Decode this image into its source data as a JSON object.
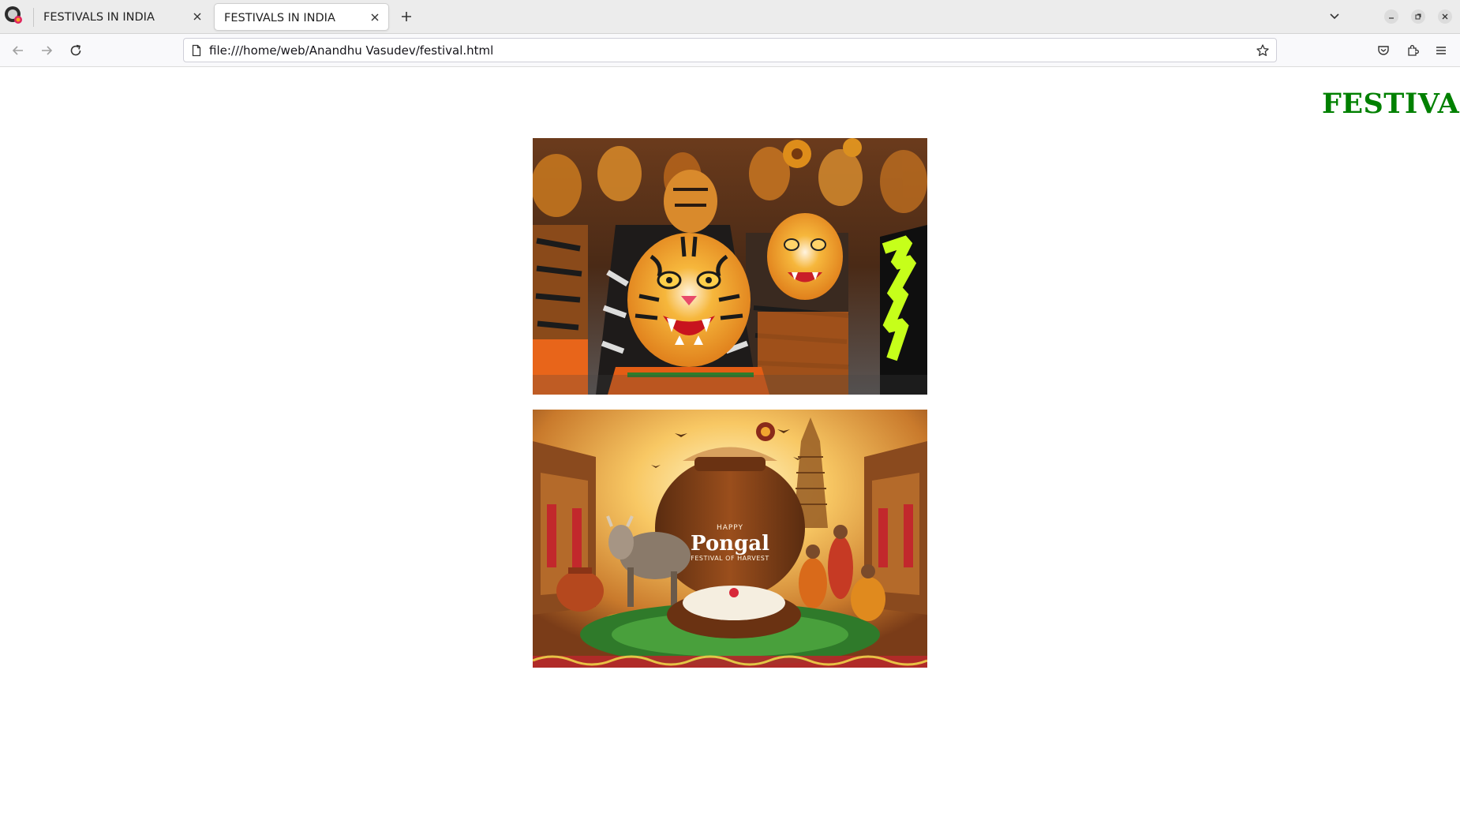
{
  "browser": {
    "tabs": [
      {
        "title": "FESTIVALS IN INDIA",
        "active": false
      },
      {
        "title": "FESTIVALS IN INDIA",
        "active": true
      }
    ],
    "url": "file:///home/web/Anandhu Vasudev/festival.html"
  },
  "page": {
    "heading": "FESTIVAI",
    "heading_color": "#008000",
    "images": [
      {
        "subject": "pulikali-tiger-dancers"
      },
      {
        "subject": "pongal-harvest-festival",
        "overlay_small": "HAPPY",
        "overlay_title": "Pongal",
        "overlay_subtitle": "FESTIVAL OF HARVEST"
      }
    ]
  },
  "icons": {
    "back": "arrow-left-icon",
    "forward": "arrow-right-icon",
    "reload": "reload-icon",
    "bookmark": "star-icon",
    "pocket": "pocket-icon",
    "extensions": "puzzle-icon",
    "menu": "hamburger-menu-icon"
  }
}
